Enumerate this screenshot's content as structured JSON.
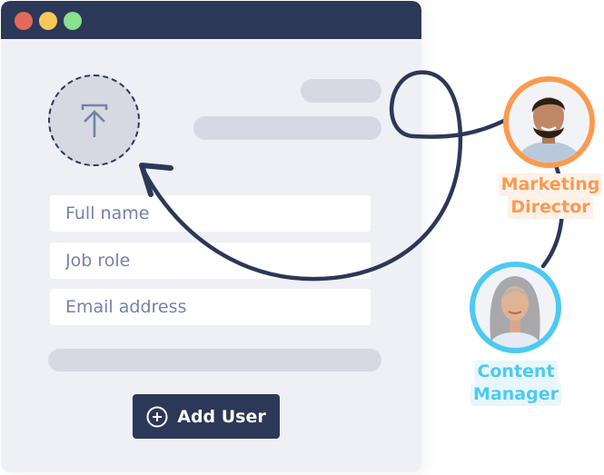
{
  "window": {
    "traffic_lights": [
      {
        "name": "close",
        "color": "#e5695a"
      },
      {
        "name": "minimize",
        "color": "#fcc65b"
      },
      {
        "name": "maximize",
        "color": "#87e18f"
      }
    ]
  },
  "form": {
    "upload_icon": "upload-icon",
    "fields": [
      {
        "name": "full-name",
        "placeholder": "Full name",
        "value": ""
      },
      {
        "name": "job-role",
        "placeholder": "Job role",
        "value": ""
      },
      {
        "name": "email-address",
        "placeholder": "Email address",
        "value": ""
      }
    ],
    "add_button": {
      "label": "Add User",
      "icon": "plus-circle-icon"
    }
  },
  "profiles": [
    {
      "role_line1": "Marketing",
      "role_line2": "Director",
      "accent": "#fc9a4f"
    },
    {
      "role_line1": "Content",
      "role_line2": "Manager",
      "accent": "#4ccaf2"
    }
  ],
  "colors": {
    "navy": "#2c3858",
    "window_bg": "#eff0f5",
    "skeleton": "#d6d9e2",
    "placeholder_text": "#7582a6"
  }
}
